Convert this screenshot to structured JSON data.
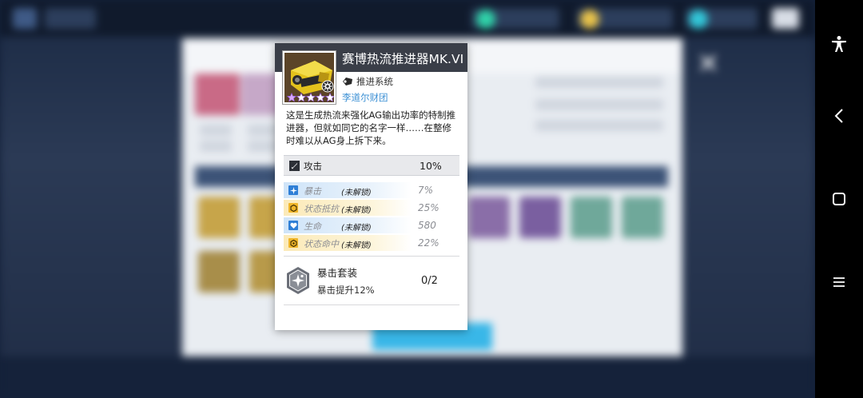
{
  "item": {
    "name": "赛博热流推进器MK.VI",
    "category": "推进系统",
    "manufacturer": "李道尔财团",
    "rarity_stars": 5,
    "description": "这是生成热流来强化AG输出功率的特制推进器，但就如同它的名字一样……在整修时难以从AG身上拆下来。"
  },
  "main_stat": {
    "label": "攻击",
    "value": "10%"
  },
  "sub_stats": [
    {
      "label": "暴击",
      "lock": "(未解锁)",
      "value": "7%",
      "icon": "crit-star-icon",
      "color": "#2f7fd6"
    },
    {
      "label": "状态抵抗",
      "lock": "(未解锁)",
      "value": "25%",
      "icon": "resist-hex-icon",
      "color": "#f0b62a"
    },
    {
      "label": "生命",
      "lock": "(未解锁)",
      "value": "580",
      "icon": "heart-icon",
      "color": "#2f7fd6"
    },
    {
      "label": "状态命中",
      "lock": "(未解锁)",
      "value": "22%",
      "icon": "hit-hex-icon",
      "color": "#f0b62a"
    }
  ],
  "set_bonus": {
    "name": "暴击套装",
    "description": "暴击提升12%",
    "progress": "0/2"
  },
  "colors": {
    "header": "#3a3e48",
    "accent_blue": "#3a8fd4",
    "accent_gold": "#f0b62a",
    "button": "#39b7e8"
  }
}
